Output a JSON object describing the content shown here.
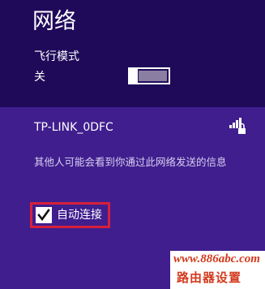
{
  "header": {
    "title": "网络",
    "airplane_mode_label": "飞行模式",
    "airplane_mode_value": "关",
    "airplane_mode_on": false
  },
  "network": {
    "name": "TP-LINK_0DFC",
    "signal_icon": "wifi-secured-signal-icon",
    "warning": "其他人可能会看到你通过此网络发送的信息",
    "auto_connect_label": "自动连接",
    "auto_connect_checked": true
  },
  "watermark": {
    "line1": "www.886abc.com",
    "line2": "路由器设置"
  },
  "colors": {
    "header_bg": "#1f0a5a",
    "panel_bg": "#401e8e",
    "highlight": "#d6203a"
  }
}
